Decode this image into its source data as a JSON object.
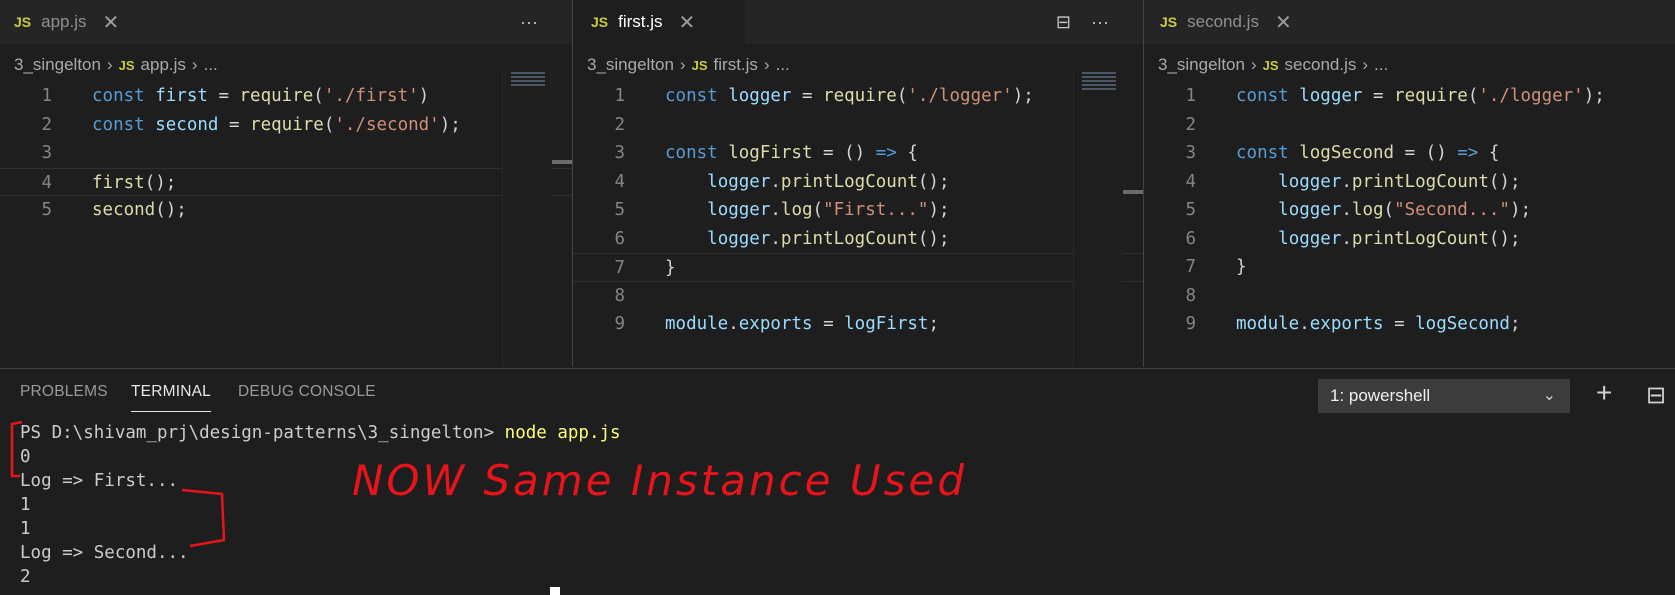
{
  "editors": [
    {
      "tab_label": "app.js",
      "tab_icon": "JS",
      "tab_close": "✕",
      "breadcrumb": {
        "folder": "3_singelton",
        "file": "app.js",
        "more": "..."
      },
      "lines": [
        {
          "n": "1",
          "tokens": [
            {
              "c": "kw",
              "t": "const "
            },
            {
              "c": "var",
              "t": "first"
            },
            {
              "c": "plain",
              "t": " = "
            },
            {
              "c": "fn",
              "t": "require"
            },
            {
              "c": "plain",
              "t": "("
            },
            {
              "c": "str",
              "t": "'./first'"
            },
            {
              "c": "plain",
              "t": ")"
            }
          ]
        },
        {
          "n": "2",
          "tokens": [
            {
              "c": "kw",
              "t": "const "
            },
            {
              "c": "var",
              "t": "second"
            },
            {
              "c": "plain",
              "t": " = "
            },
            {
              "c": "fn",
              "t": "require"
            },
            {
              "c": "plain",
              "t": "("
            },
            {
              "c": "str",
              "t": "'./second'"
            },
            {
              "c": "plain",
              "t": ");"
            }
          ]
        },
        {
          "n": "3",
          "tokens": []
        },
        {
          "n": "4",
          "tokens": [
            {
              "c": "fn",
              "t": "first"
            },
            {
              "c": "plain",
              "t": "();"
            }
          ]
        },
        {
          "n": "5",
          "tokens": [
            {
              "c": "fn",
              "t": "second"
            },
            {
              "c": "plain",
              "t": "();"
            }
          ]
        }
      ]
    },
    {
      "tab_label": "first.js",
      "tab_icon": "JS",
      "tab_close": "✕",
      "breadcrumb": {
        "folder": "3_singelton",
        "file": "first.js",
        "more": "..."
      },
      "lines": [
        {
          "n": "1",
          "tokens": [
            {
              "c": "kw",
              "t": "const "
            },
            {
              "c": "var",
              "t": "logger"
            },
            {
              "c": "plain",
              "t": " = "
            },
            {
              "c": "fn",
              "t": "require"
            },
            {
              "c": "plain",
              "t": "("
            },
            {
              "c": "str",
              "t": "'./logger'"
            },
            {
              "c": "plain",
              "t": ");"
            }
          ]
        },
        {
          "n": "2",
          "tokens": []
        },
        {
          "n": "3",
          "tokens": [
            {
              "c": "kw",
              "t": "const "
            },
            {
              "c": "fn",
              "t": "logFirst"
            },
            {
              "c": "plain",
              "t": " = () "
            },
            {
              "c": "kw",
              "t": "=>"
            },
            {
              "c": "plain",
              "t": " {"
            }
          ]
        },
        {
          "n": "4",
          "tokens": [
            {
              "c": "plain",
              "t": "    "
            },
            {
              "c": "var",
              "t": "logger"
            },
            {
              "c": "plain",
              "t": "."
            },
            {
              "c": "fn",
              "t": "printLogCount"
            },
            {
              "c": "plain",
              "t": "();"
            }
          ]
        },
        {
          "n": "5",
          "tokens": [
            {
              "c": "plain",
              "t": "    "
            },
            {
              "c": "var",
              "t": "logger"
            },
            {
              "c": "plain",
              "t": "."
            },
            {
              "c": "fn",
              "t": "log"
            },
            {
              "c": "plain",
              "t": "("
            },
            {
              "c": "str",
              "t": "\"First...\""
            },
            {
              "c": "plain",
              "t": ");"
            }
          ]
        },
        {
          "n": "6",
          "tokens": [
            {
              "c": "plain",
              "t": "    "
            },
            {
              "c": "var",
              "t": "logger"
            },
            {
              "c": "plain",
              "t": "."
            },
            {
              "c": "fn",
              "t": "printLogCount"
            },
            {
              "c": "plain",
              "t": "();"
            }
          ]
        },
        {
          "n": "7",
          "tokens": [
            {
              "c": "plain",
              "t": "}"
            }
          ]
        },
        {
          "n": "8",
          "tokens": []
        },
        {
          "n": "9",
          "tokens": [
            {
              "c": "var",
              "t": "module"
            },
            {
              "c": "plain",
              "t": "."
            },
            {
              "c": "var",
              "t": "exports"
            },
            {
              "c": "plain",
              "t": " = "
            },
            {
              "c": "var",
              "t": "logFirst"
            },
            {
              "c": "plain",
              "t": ";"
            }
          ]
        }
      ]
    },
    {
      "tab_label": "second.js",
      "tab_icon": "JS",
      "tab_close": "✕",
      "breadcrumb": {
        "folder": "3_singelton",
        "file": "second.js",
        "more": "..."
      },
      "lines": [
        {
          "n": "1",
          "tokens": [
            {
              "c": "kw",
              "t": "const "
            },
            {
              "c": "var",
              "t": "logger"
            },
            {
              "c": "plain",
              "t": " = "
            },
            {
              "c": "fn",
              "t": "require"
            },
            {
              "c": "plain",
              "t": "("
            },
            {
              "c": "str",
              "t": "'./logger'"
            },
            {
              "c": "plain",
              "t": ");"
            }
          ]
        },
        {
          "n": "2",
          "tokens": []
        },
        {
          "n": "3",
          "tokens": [
            {
              "c": "kw",
              "t": "const "
            },
            {
              "c": "fn",
              "t": "logSecond"
            },
            {
              "c": "plain",
              "t": " = () "
            },
            {
              "c": "kw",
              "t": "=>"
            },
            {
              "c": "plain",
              "t": " {"
            }
          ]
        },
        {
          "n": "4",
          "tokens": [
            {
              "c": "plain",
              "t": "    "
            },
            {
              "c": "var",
              "t": "logger"
            },
            {
              "c": "plain",
              "t": "."
            },
            {
              "c": "fn",
              "t": "printLogCount"
            },
            {
              "c": "plain",
              "t": "();"
            }
          ]
        },
        {
          "n": "5",
          "tokens": [
            {
              "c": "plain",
              "t": "    "
            },
            {
              "c": "var",
              "t": "logger"
            },
            {
              "c": "plain",
              "t": "."
            },
            {
              "c": "fn",
              "t": "log"
            },
            {
              "c": "plain",
              "t": "("
            },
            {
              "c": "str",
              "t": "\"Second...\""
            },
            {
              "c": "plain",
              "t": ");"
            }
          ]
        },
        {
          "n": "6",
          "tokens": [
            {
              "c": "plain",
              "t": "    "
            },
            {
              "c": "var",
              "t": "logger"
            },
            {
              "c": "plain",
              "t": "."
            },
            {
              "c": "fn",
              "t": "printLogCount"
            },
            {
              "c": "plain",
              "t": "();"
            }
          ]
        },
        {
          "n": "7",
          "tokens": [
            {
              "c": "plain",
              "t": "}"
            }
          ]
        },
        {
          "n": "8",
          "tokens": []
        },
        {
          "n": "9",
          "tokens": [
            {
              "c": "var",
              "t": "module"
            },
            {
              "c": "plain",
              "t": "."
            },
            {
              "c": "var",
              "t": "exports"
            },
            {
              "c": "plain",
              "t": " = "
            },
            {
              "c": "var",
              "t": "logSecond"
            },
            {
              "c": "plain",
              "t": ";"
            }
          ]
        }
      ]
    }
  ],
  "tab_actions": {
    "more": "···",
    "split": "⊟"
  },
  "panel": {
    "tabs": [
      "PROBLEMS",
      "TERMINAL",
      "DEBUG CONSOLE"
    ],
    "shell_select": "1: powershell",
    "chevron": "⌄",
    "add": "+",
    "split": "⊟"
  },
  "terminal": {
    "prompt": "PS D:\\shivam_prj\\design-patterns\\3_singelton> ",
    "command": "node app.js",
    "output": [
      "0",
      "Log => First...",
      "1",
      "1",
      "Log => Second...",
      "2"
    ]
  },
  "annotation_text": "NOW Same Instance Used",
  "colors": {
    "keyword": "#569cd6",
    "function": "#dcdcaa",
    "string": "#ce9178",
    "variable": "#9cdcfe",
    "annotation": "#e8141c"
  }
}
